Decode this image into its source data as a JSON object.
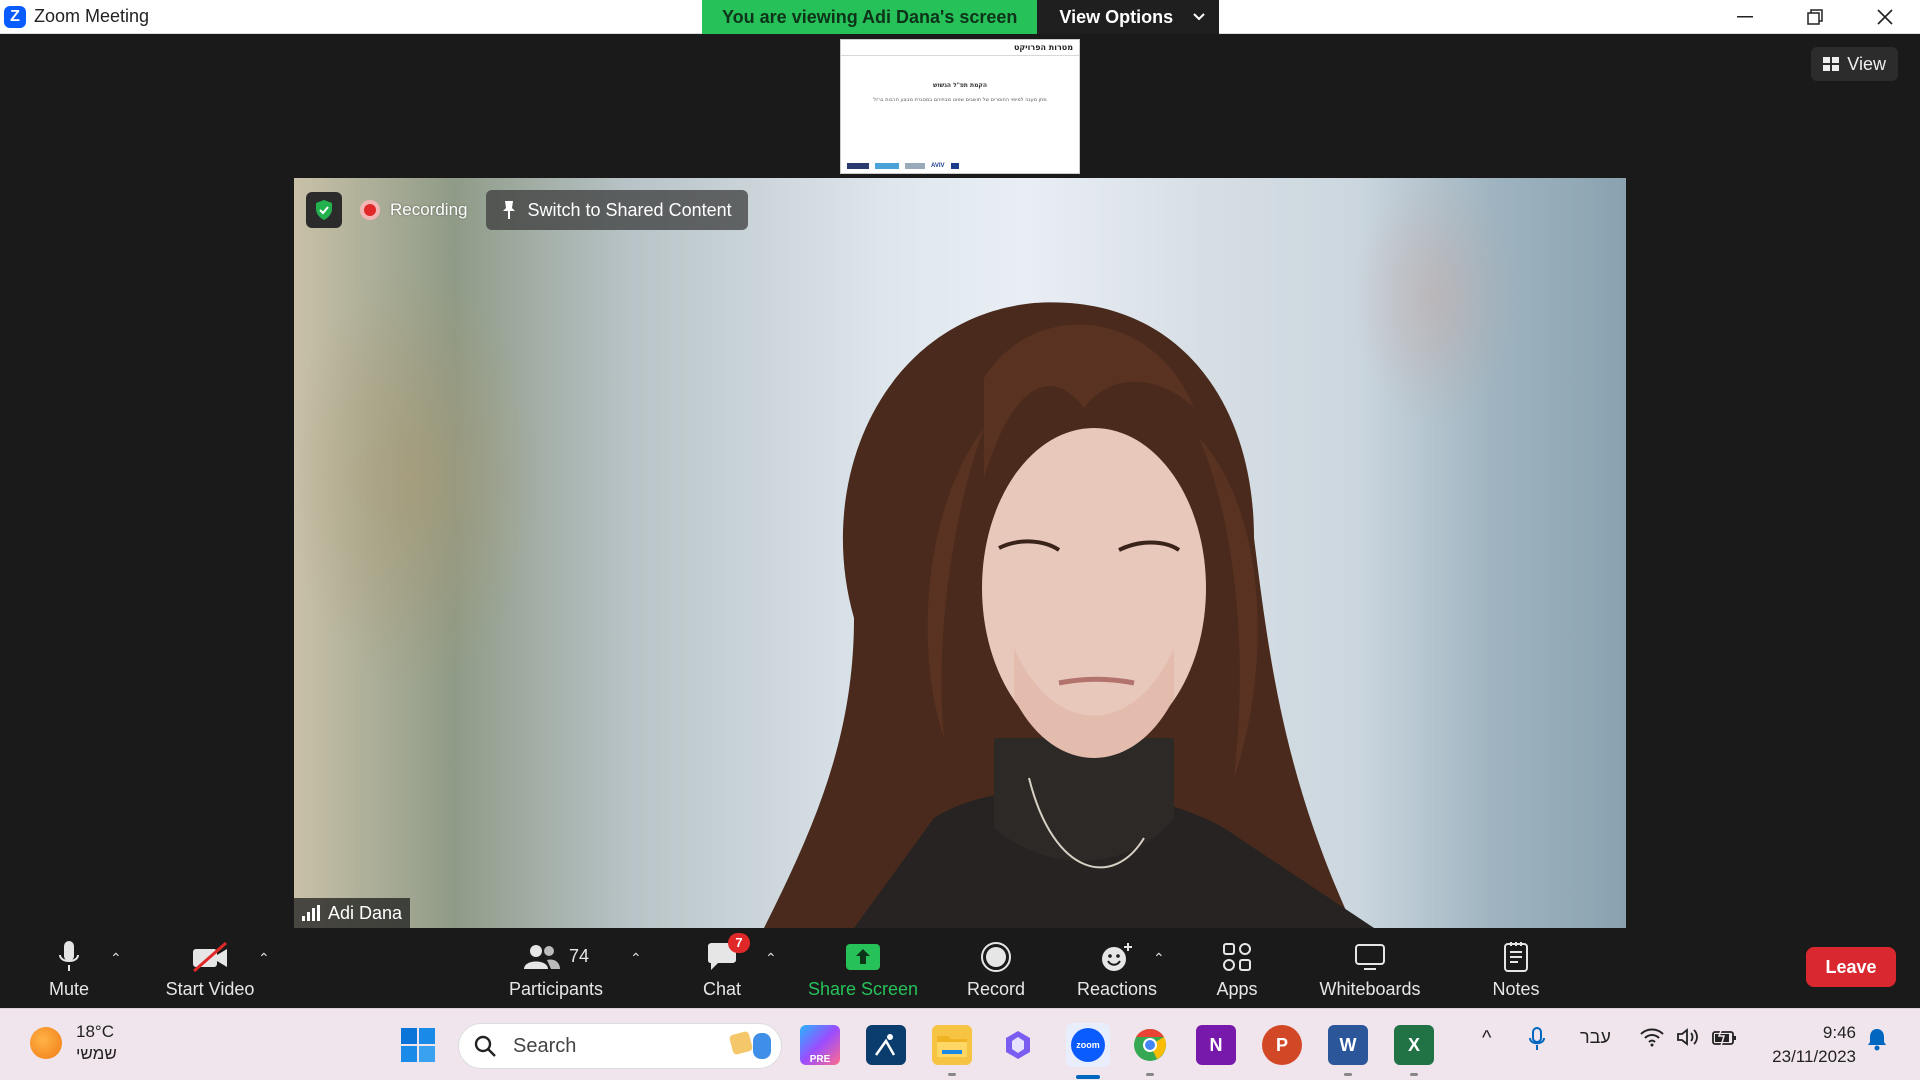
{
  "window": {
    "title": "Zoom Meeting",
    "logo_letter": "Z",
    "minimize_icon": "minimize-icon",
    "restore_icon": "restore-icon",
    "close_icon": "close-icon"
  },
  "share_banner": {
    "viewing_text": "You are viewing Adi Dana's screen",
    "view_options_label": "View Options"
  },
  "view_button": {
    "label": "View"
  },
  "shared_thumbnail": {
    "heading": "מטרות הפרויקט",
    "subheading": "הקמת תפ\"ל הגשוש",
    "line": "מתן מענה למיפוי החוסרים של תושבים שפונו מבתיהם במסגרת מבצע חרבות ברזל",
    "logo_text": "AVIV"
  },
  "overlay": {
    "recording_label": "Recording",
    "switch_label": "Switch to Shared Content"
  },
  "participant": {
    "name": "Adi Dana"
  },
  "toolbar": {
    "mute_label": "Mute",
    "start_video_label": "Start Video",
    "participants_label": "Participants",
    "participants_count": "74",
    "chat_label": "Chat",
    "chat_badge": "7",
    "share_screen_label": "Share Screen",
    "record_label": "Record",
    "reactions_label": "Reactions",
    "apps_label": "Apps",
    "whiteboards_label": "Whiteboards",
    "notes_label": "Notes",
    "leave_label": "Leave"
  },
  "taskbar": {
    "temperature": "18°C",
    "weather_desc": "שמשי",
    "search_placeholder": "Search",
    "language": "עבר",
    "time": "9:46",
    "date": "23/11/2023",
    "onenote_letter": "N",
    "powerpoint_letter": "P",
    "word_letter": "W",
    "excel_letter": "X",
    "zoom_text": "zoom"
  },
  "colors": {
    "banner_green": "#27c15a",
    "share_green": "#27c15a",
    "leave_red": "#d9282f",
    "badge_red": "#e02828",
    "zoom_blue": "#0b5cff"
  }
}
